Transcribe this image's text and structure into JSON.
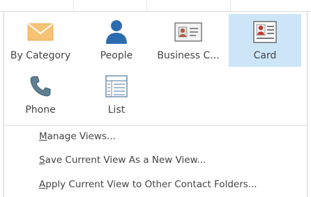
{
  "views": [
    {
      "label": "By Category",
      "icon": "envelope-icon",
      "selected": false
    },
    {
      "label": "People",
      "icon": "person-icon",
      "selected": false
    },
    {
      "label": "Business C...",
      "icon": "business-card-icon",
      "selected": false
    },
    {
      "label": "Card",
      "icon": "contact-card-icon",
      "selected": true
    },
    {
      "label": "Phone",
      "icon": "phone-icon",
      "selected": false
    },
    {
      "label": "List",
      "icon": "list-icon",
      "selected": false
    }
  ],
  "menu": {
    "manage_views": {
      "mnemonic": "M",
      "rest": "anage Views..."
    },
    "save_view": {
      "mnemonic": "S",
      "rest": "ave Current View As a New View..."
    },
    "apply_view": {
      "mnemonic": "A",
      "rest": "pply Current View to Other Contact Folders..."
    }
  },
  "colors": {
    "selected_tile": "#cde6f7",
    "envelope": "#f5c276",
    "person": "#2b6cb0"
  }
}
